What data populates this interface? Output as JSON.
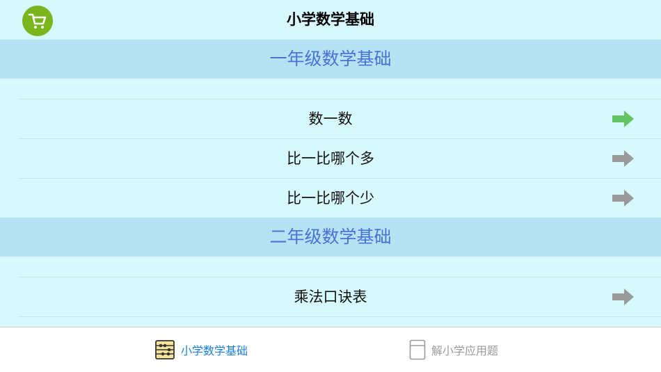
{
  "header": {
    "title": "小学数学基础",
    "cart_icon": "shopping-cart-icon"
  },
  "sections": [
    {
      "title": "一年级数学基础",
      "items": [
        {
          "label": "数一数",
          "arrow_color": "#66c466"
        },
        {
          "label": "比一比哪个多",
          "arrow_color": "#9a9a9a"
        },
        {
          "label": "比一比哪个少",
          "arrow_color": "#9a9a9a"
        }
      ]
    },
    {
      "title": "二年级数学基础",
      "items": [
        {
          "label": "乘法口诀表",
          "arrow_color": "#9a9a9a"
        }
      ]
    }
  ],
  "tabs": [
    {
      "label": "小学数学基础",
      "icon": "abacus-icon",
      "active": true
    },
    {
      "label": "解小学应用题",
      "icon": "calculator-icon",
      "active": false
    }
  ],
  "colors": {
    "background": "#d7f8fd",
    "section_header": "#b6e2f4",
    "section_title": "#4a72d8",
    "cart_green": "#7ab51d",
    "active_tab": "#1a7ee0",
    "inactive_tab": "#9a9a9a"
  }
}
